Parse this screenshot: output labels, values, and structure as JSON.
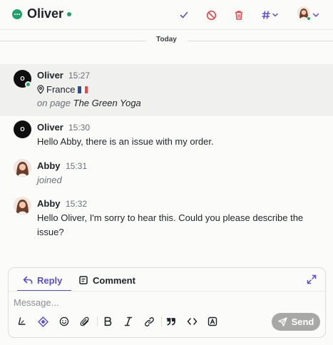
{
  "header": {
    "contact_name": "Oliver",
    "online": true,
    "actions": [
      "check-icon",
      "block-icon",
      "trash-icon",
      "hashtag-icon",
      "agent-avatar"
    ]
  },
  "divider": {
    "label": "Today"
  },
  "messages": [
    {
      "author": "Oliver",
      "time": "15:27",
      "location": "France",
      "page_prefix": "on page",
      "page_name": "The Green Yoga",
      "avatar_initial": "O"
    },
    {
      "author": "Oliver",
      "time": "15:30",
      "text": "Hello Abby, there is an issue with my order.",
      "avatar_initial": "O"
    },
    {
      "author": "Abby",
      "time": "15:31",
      "text": "joined"
    },
    {
      "author": "Abby",
      "time": "15:32",
      "text": "Hello Oliver, I'm sorry to hear this. Could you please describe the issue?"
    }
  ],
  "composer": {
    "tabs": [
      {
        "label": "Reply",
        "active": true
      },
      {
        "label": "Comment",
        "active": false
      }
    ],
    "placeholder": "Message...",
    "value": "",
    "send_label": "Send",
    "toolbar": [
      "signature-icon",
      "ai-sparkle-icon",
      "emoji-icon",
      "attach-icon",
      "bold-icon",
      "italic-icon",
      "link-icon",
      "quote-icon",
      "code-icon",
      "saved-reply-icon"
    ]
  },
  "colors": {
    "accent": "#5b4fd0",
    "online": "#22a06b",
    "danger": "#e5484d",
    "highlight_bg": "#f0f0ee",
    "send_disabled": "#a8a8a6"
  }
}
